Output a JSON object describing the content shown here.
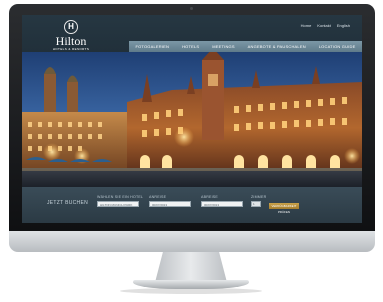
{
  "brand": {
    "badge": "H",
    "name": "Hilton",
    "subtitle": "HOTELS & RESORTS"
  },
  "top_links": [
    "Home",
    "Kontakt",
    "English"
  ],
  "main_nav": [
    "FOTOGALERIEN",
    "HOTELS",
    "MEETINGS",
    "ANGEBOTE & PAUSCHALEN",
    "LOCATION GUIDE"
  ],
  "booking": {
    "heading": "JETZT BUCHEN",
    "hotel_label": "WÄHLEN SIE EIN HOTEL",
    "hotel_value": "HILTON MUNICH PARK",
    "arrival_label": "ANREISE",
    "arrival_value": "00/07/2013",
    "departure_label": "ABREISE",
    "departure_value": "00/07/2013",
    "rooms_label": "ZIMMER",
    "rooms_value": "1",
    "submit_label": "VERFÜGBARKEIT PRÜFEN"
  },
  "colors": {
    "nav_bar": "#6f8b9a",
    "header_bg": "#233440",
    "cta": "#b88f3b",
    "sky": "#2a4f86"
  }
}
